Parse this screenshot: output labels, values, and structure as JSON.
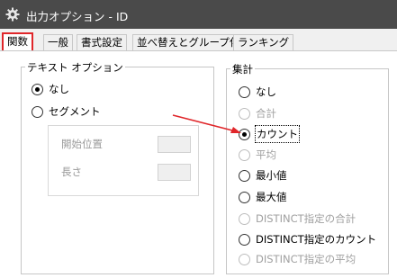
{
  "window": {
    "title": "出力オプション - ID",
    "icon": "gear-icon"
  },
  "tabs": [
    {
      "label": "関数",
      "active": true
    },
    {
      "label": "一般"
    },
    {
      "label": "書式設定"
    },
    {
      "label": "並べ替えとグループ化"
    },
    {
      "label": "ランキング"
    }
  ],
  "text_options": {
    "legend": "テキスト オプション",
    "none": "なし",
    "segment": "セグメント",
    "start_position": "開始位置",
    "length": "長さ"
  },
  "aggregate": {
    "legend": "集計",
    "items": [
      {
        "label": "なし",
        "state": "enabled"
      },
      {
        "label": "合計",
        "state": "disabled"
      },
      {
        "label": "カウント",
        "state": "selected"
      },
      {
        "label": "平均",
        "state": "disabled"
      },
      {
        "label": "最小値",
        "state": "enabled"
      },
      {
        "label": "最大値",
        "state": "enabled"
      },
      {
        "label": "DISTINCT指定の合計",
        "state": "disabled"
      },
      {
        "label": "DISTINCT指定のカウント",
        "state": "enabled"
      },
      {
        "label": "DISTINCT指定の平均",
        "state": "disabled"
      }
    ]
  },
  "colors": {
    "tab_highlight": "#e0262a",
    "arrow": "#e0262a",
    "titlebar": "#4a4a4a"
  }
}
